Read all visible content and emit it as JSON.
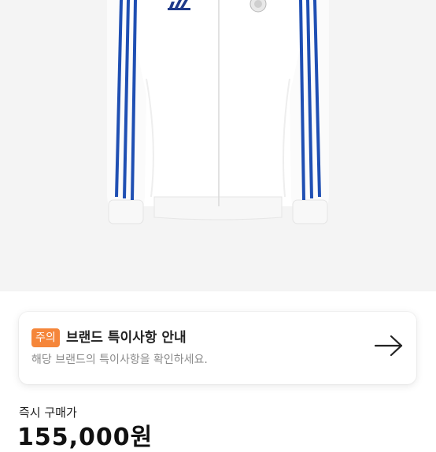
{
  "colors": {
    "badge_bg": "#f5863a",
    "stripe_blue": "#1f4fb3",
    "product_bg": "#f4f4f4"
  },
  "product": {
    "image_name": "white-track-jacket-with-blue-stripes"
  },
  "notice": {
    "badge": "주의",
    "title": "브랜드 특이사항 안내",
    "subtitle": "해당 브랜드의 특이사항을 확인하세요.",
    "arrow_icon": "arrow-right-icon"
  },
  "price": {
    "label": "즉시 구매가",
    "value": "155,000원"
  }
}
